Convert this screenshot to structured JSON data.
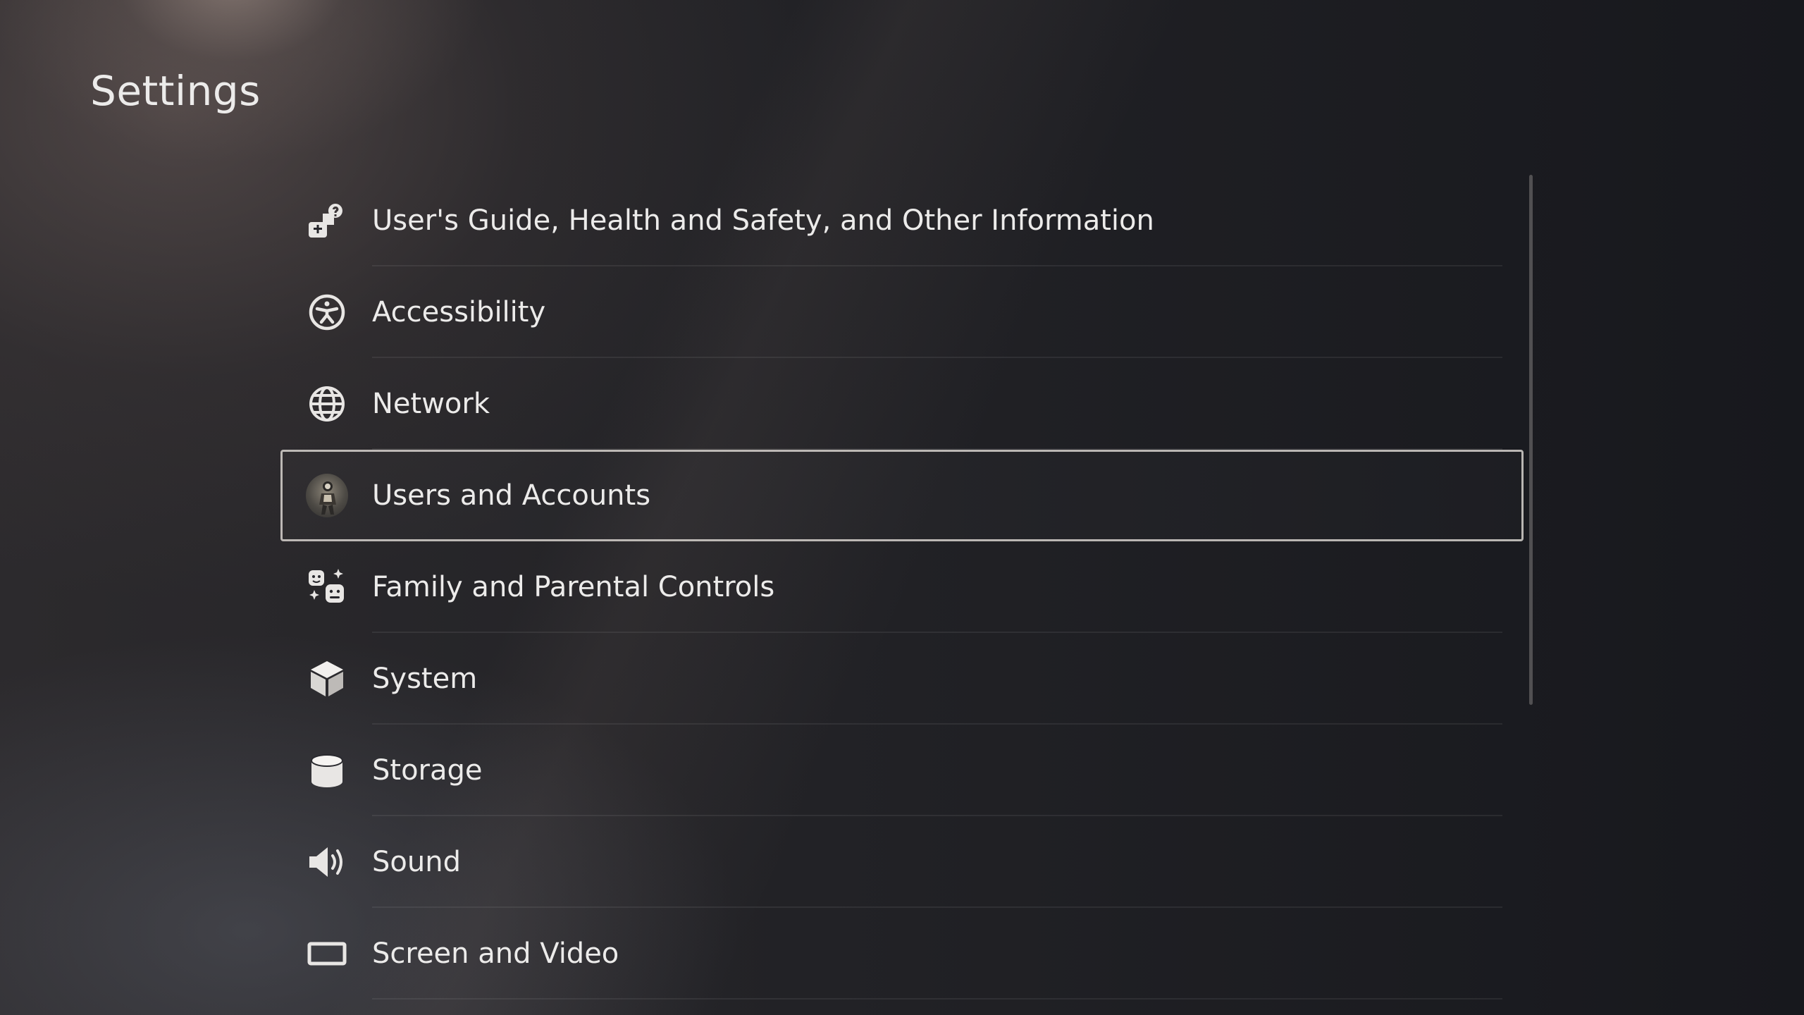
{
  "page": {
    "title": "Settings"
  },
  "settings": {
    "items": [
      {
        "label": "User's Guide, Health and Safety, and Other Information",
        "icon": "guide-icon"
      },
      {
        "label": "Accessibility",
        "icon": "accessibility-icon"
      },
      {
        "label": "Network",
        "icon": "globe-icon"
      },
      {
        "label": "Users and Accounts",
        "icon": "user-avatar",
        "selected": true
      },
      {
        "label": "Family and Parental Controls",
        "icon": "family-icon"
      },
      {
        "label": "System",
        "icon": "cube-icon"
      },
      {
        "label": "Storage",
        "icon": "storage-icon"
      },
      {
        "label": "Sound",
        "icon": "speaker-icon"
      },
      {
        "label": "Screen and Video",
        "icon": "screen-icon"
      }
    ]
  },
  "colors": {
    "text": "#ecebea",
    "selection_outline": "#e1dcd7",
    "background": "#1c1d22"
  }
}
